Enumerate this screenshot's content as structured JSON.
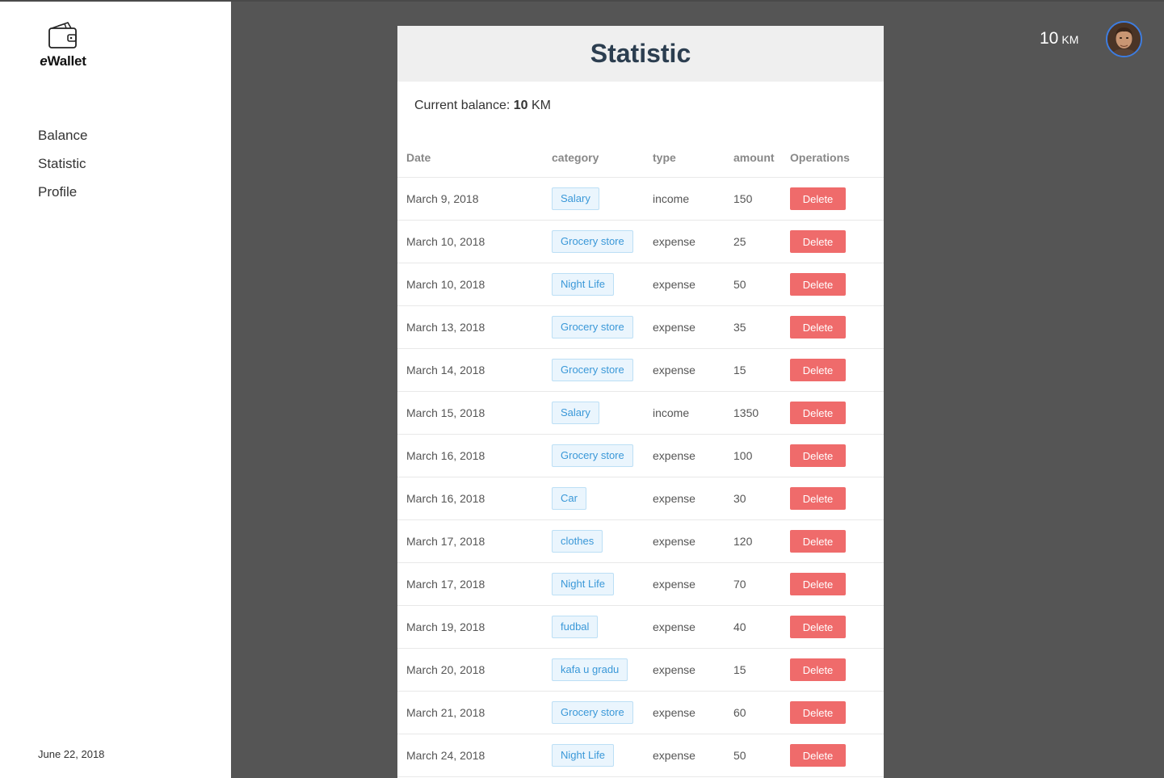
{
  "app": {
    "brand_prefix": "e",
    "brand_suffix": "Wallet",
    "logo_icon": "wallet-icon"
  },
  "sidebar": {
    "items": [
      {
        "label": "Balance"
      },
      {
        "label": "Statistic"
      },
      {
        "label": "Profile"
      }
    ],
    "date": "June 22, 2018"
  },
  "header": {
    "balance_value": "10",
    "balance_currency": "KM"
  },
  "panel": {
    "title": "Statistic",
    "current_balance_label": "Current balance:",
    "current_balance_value": "10",
    "current_balance_currency": "KM"
  },
  "table": {
    "columns": [
      "Date",
      "category",
      "type",
      "amount",
      "Operations"
    ],
    "delete_label": "Delete",
    "rows": [
      {
        "date": "March 9, 2018",
        "category": "Salary",
        "type": "income",
        "amount": "150"
      },
      {
        "date": "March 10, 2018",
        "category": "Grocery store",
        "type": "expense",
        "amount": "25"
      },
      {
        "date": "March 10, 2018",
        "category": "Night Life",
        "type": "expense",
        "amount": "50"
      },
      {
        "date": "March 13, 2018",
        "category": "Grocery store",
        "type": "expense",
        "amount": "35"
      },
      {
        "date": "March 14, 2018",
        "category": "Grocery store",
        "type": "expense",
        "amount": "15"
      },
      {
        "date": "March 15, 2018",
        "category": "Salary",
        "type": "income",
        "amount": "1350"
      },
      {
        "date": "March 16, 2018",
        "category": "Grocery store",
        "type": "expense",
        "amount": "100"
      },
      {
        "date": "March 16, 2018",
        "category": "Car",
        "type": "expense",
        "amount": "30"
      },
      {
        "date": "March 17, 2018",
        "category": "clothes",
        "type": "expense",
        "amount": "120"
      },
      {
        "date": "March 17, 2018",
        "category": "Night Life",
        "type": "expense",
        "amount": "70"
      },
      {
        "date": "March 19, 2018",
        "category": "fudbal",
        "type": "expense",
        "amount": "40"
      },
      {
        "date": "March 20, 2018",
        "category": "kafa u gradu",
        "type": "expense",
        "amount": "15"
      },
      {
        "date": "March 21, 2018",
        "category": "Grocery store",
        "type": "expense",
        "amount": "60"
      },
      {
        "date": "March 24, 2018",
        "category": "Night Life",
        "type": "expense",
        "amount": "50"
      }
    ]
  },
  "colors": {
    "background": "#555555",
    "accent_delete": "#ef6b6b",
    "tag_text": "#3a98d8",
    "tag_bg": "#eaf5fd",
    "avatar_ring": "#3d7de0"
  }
}
